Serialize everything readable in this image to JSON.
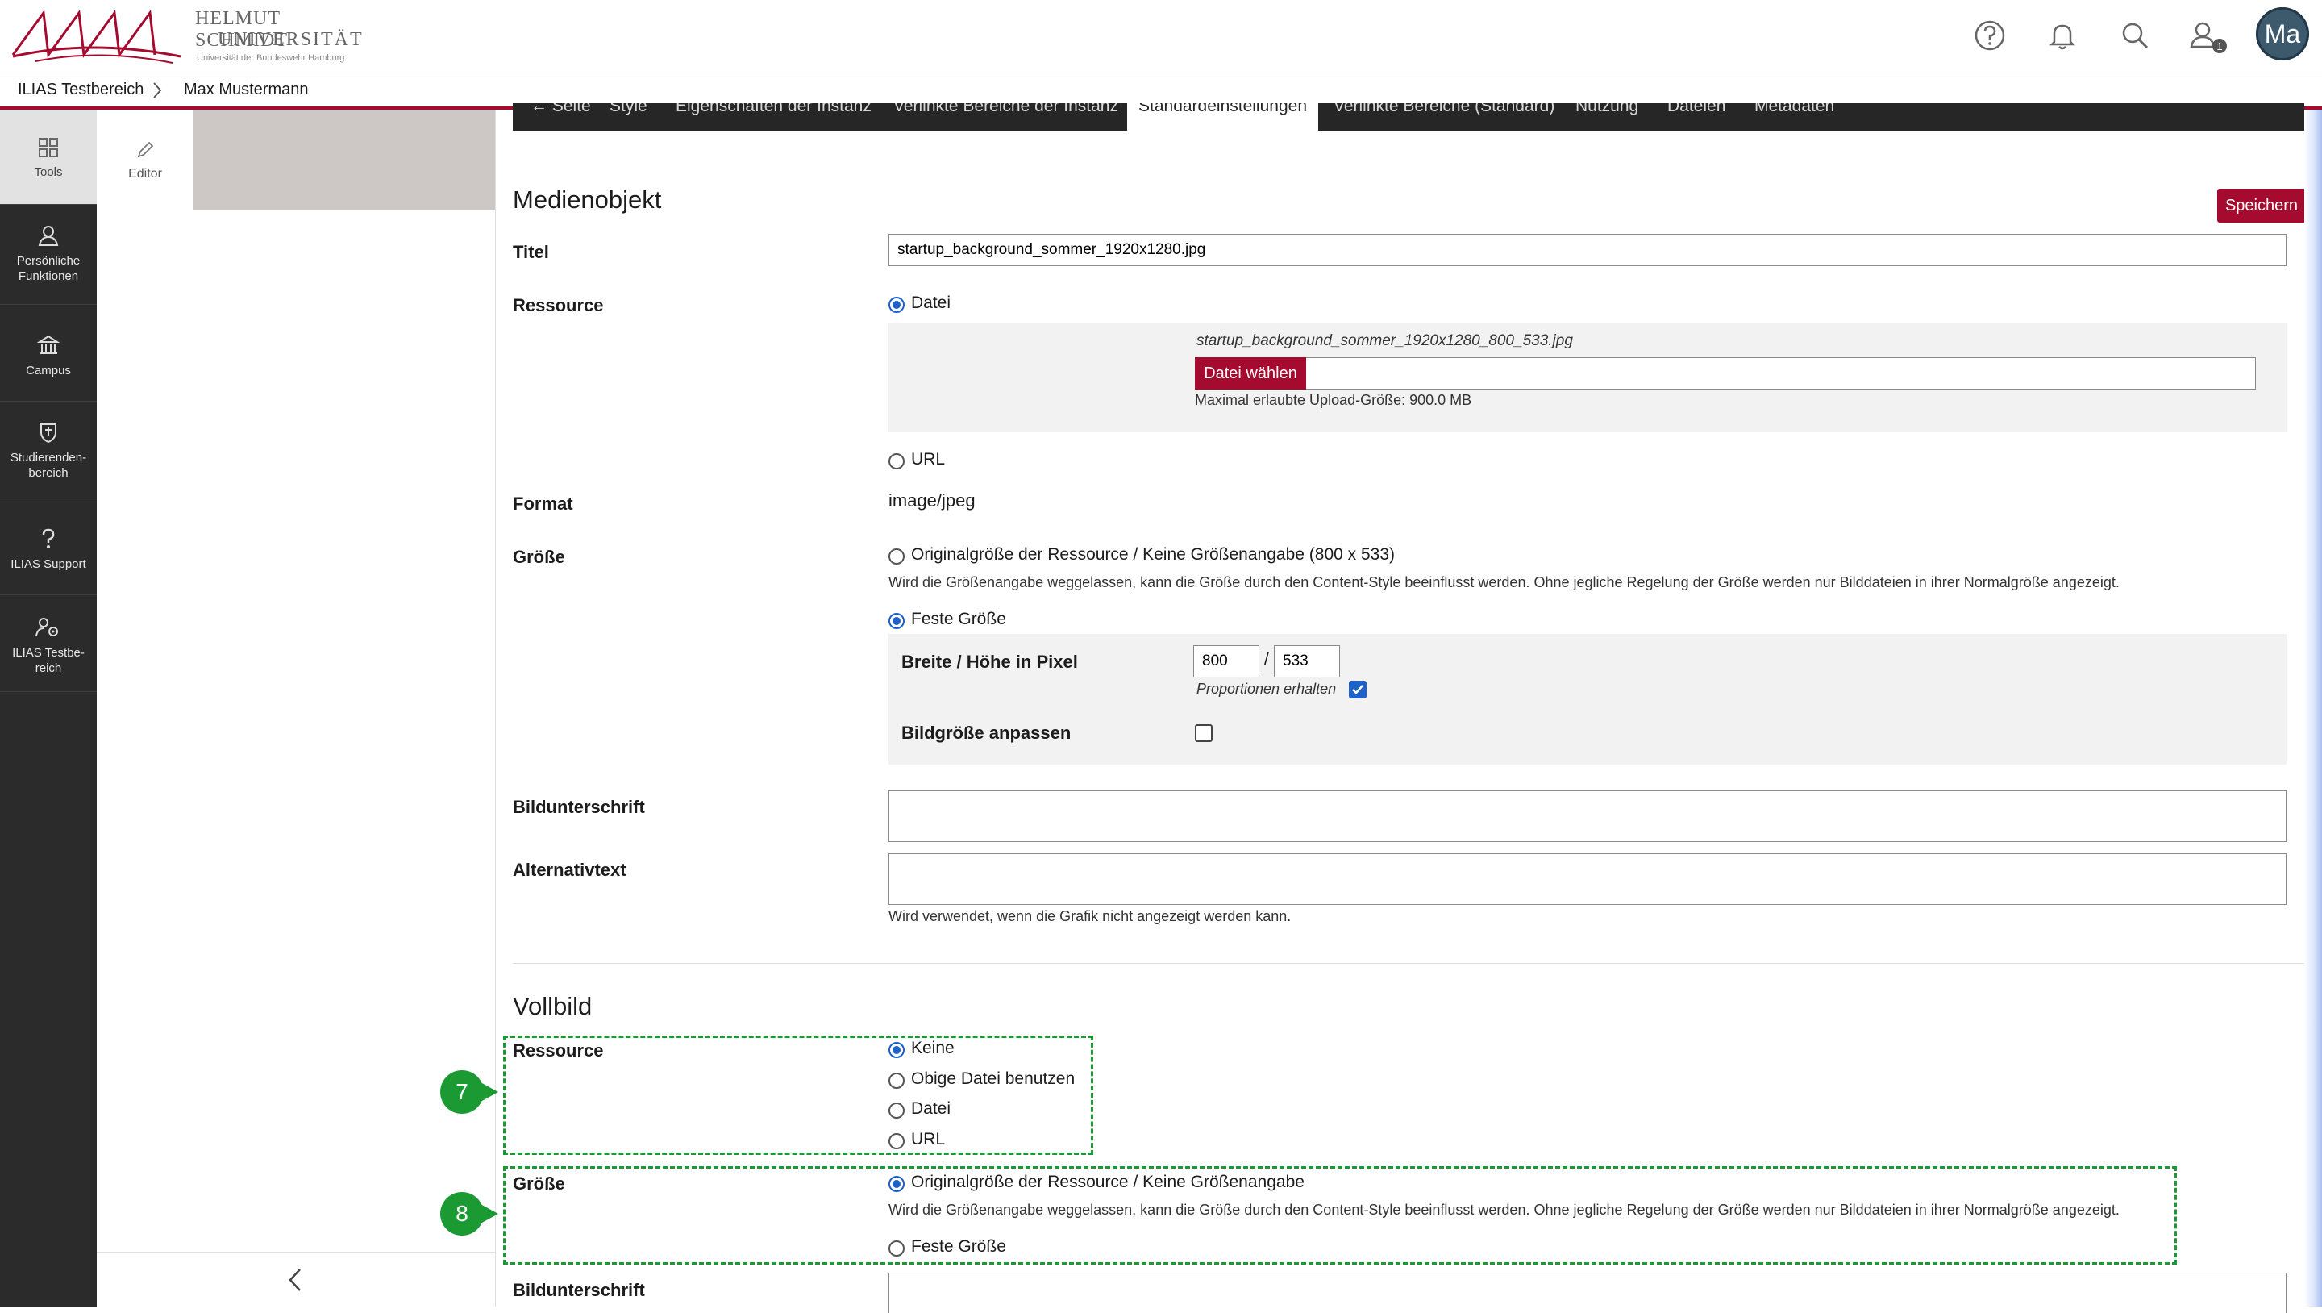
{
  "header": {
    "logo_line1": "HELMUT SCHMIDT",
    "logo_line2": "UNIVERSITÄT",
    "logo_line3": "Universität der Bundeswehr Hamburg",
    "badge_count": "1",
    "avatar_initials": "Ma",
    "icons": [
      "help-icon",
      "bell-icon",
      "search-icon",
      "user-icon"
    ]
  },
  "breadcrumb": [
    "ILIAS Testbereich",
    "Max Mustermann"
  ],
  "mainbar": [
    {
      "label": "Tools",
      "icon": "tools-icon"
    },
    {
      "label": "Persönliche Funktionen",
      "icon": "person-icon"
    },
    {
      "label": "Campus",
      "icon": "campus-icon"
    },
    {
      "label": "Studierenden-bereich",
      "icon": "shield-icon"
    },
    {
      "label": "ILIAS Support",
      "icon": "question-icon"
    },
    {
      "label": "ILIAS Testbe-reich",
      "icon": "gear-users-icon"
    }
  ],
  "slate": {
    "editor_label": "Editor"
  },
  "tabs": [
    "Seite",
    "Style",
    "Eigenschaften der Instanz",
    "Verlinkte Bereiche der Instanz",
    "Standardeinstellungen",
    "Verlinkte Bereiche (Standard)",
    "Nutzung",
    "Dateien",
    "Metadaten"
  ],
  "medienobjekt": {
    "heading": "Medienobjekt",
    "save_label": "Speichern",
    "titel_label": "Titel",
    "titel_value": "startup_background_sommer_1920x1280.jpg",
    "ressource_label": "Ressource",
    "ressource_datei": "Datei",
    "current_file": "startup_background_sommer_1920x1280_800_533.jpg",
    "choose_file": "Datei wählen",
    "max_upload": "Maximal erlaubte Upload-Größe: 900.0 MB",
    "ressource_url": "URL",
    "format_label": "Format",
    "format_value": "image/jpeg",
    "groesse_label": "Größe",
    "groesse_original": "Originalgröße der Ressource / Keine Größenangabe (800 x 533)",
    "groesse_info": "Wird die Größenangabe weggelassen, kann die Größe durch den Content-Style beeinflusst werden. Ohne jegliche Regelung der Größe werden nur Bilddateien in ihrer Normalgröße angezeigt.",
    "groesse_fest": "Feste Größe",
    "breite_label": "Breite / Höhe in Pixel",
    "breite_value": "800",
    "hoehe_value": "533",
    "slash": "/",
    "proportionen": "Proportionen erhalten",
    "bildgroesse_label": "Bildgröße anpassen",
    "bildunterschrift_label": "Bildunterschrift",
    "alternativtext_label": "Alternativtext",
    "alternativtext_info": "Wird verwendet, wenn die Grafik nicht angezeigt werden kann."
  },
  "vollbild": {
    "heading": "Vollbild",
    "ressource_label": "Ressource",
    "options": [
      "Keine",
      "Obige Datei benutzen",
      "Datei",
      "URL"
    ],
    "groesse_label": "Größe",
    "groesse_original": "Originalgröße der Ressource / Keine Größenangabe",
    "groesse_info": "Wird die Größenangabe weggelassen, kann die Größe durch den Content-Style beeinflusst werden. Ohne jegliche Regelung der Größe werden nur Bilddateien in ihrer Normalgröße angezeigt.",
    "groesse_fest": "Feste Größe",
    "bildunterschrift_label": "Bildunterschrift",
    "marker7": "7",
    "marker8": "8"
  },
  "colors": {
    "accent": "#a50b2f",
    "annotation": "#1b9a34",
    "radio": "#1f62c7"
  }
}
